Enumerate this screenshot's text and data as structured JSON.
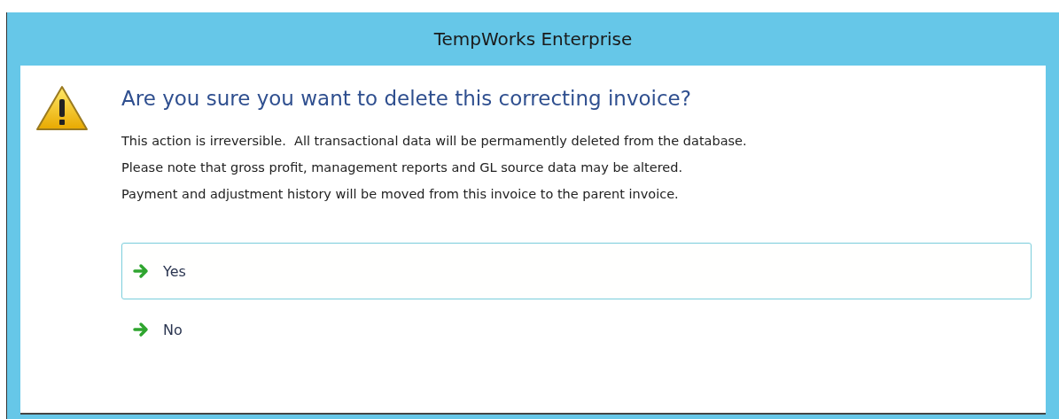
{
  "window": {
    "title": "TempWorks Enterprise"
  },
  "dialog": {
    "heading": "Are you sure you want to delete this correcting invoice?",
    "message_lines": [
      "This action is irreversible.  All transactional data will be permamently deleted from the database.",
      "Please note that gross profit, management reports and GL source data may be altered.",
      "Payment and adjustment history will be moved from this invoice to the parent invoice."
    ],
    "options": [
      {
        "label": "Yes",
        "selected": true
      },
      {
        "label": "No",
        "selected": false
      }
    ]
  }
}
